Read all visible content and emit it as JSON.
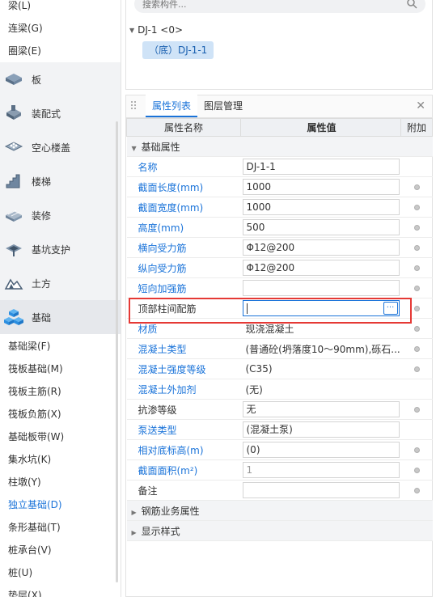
{
  "left_nav": {
    "top_items": [
      {
        "label": "梁(L)"
      },
      {
        "label": "连梁(G)"
      },
      {
        "label": "圈梁(E)"
      }
    ],
    "categories": [
      {
        "label": "板",
        "icon": "slab-icon"
      },
      {
        "label": "装配式",
        "icon": "prefab-icon"
      },
      {
        "label": "空心楼盖",
        "icon": "hollow-floor-icon"
      },
      {
        "label": "楼梯",
        "icon": "stairs-icon"
      },
      {
        "label": "装修",
        "icon": "decoration-icon"
      },
      {
        "label": "基坑支护",
        "icon": "pit-support-icon"
      },
      {
        "label": "土方",
        "icon": "earthwork-icon"
      },
      {
        "label": "基础",
        "icon": "foundation-icon",
        "active": true
      }
    ],
    "sub_items": [
      {
        "label": "基础梁(F)"
      },
      {
        "label": "筏板基础(M)"
      },
      {
        "label": "筏板主筋(R)"
      },
      {
        "label": "筏板负筋(X)"
      },
      {
        "label": "基础板带(W)"
      },
      {
        "label": "集水坑(K)"
      },
      {
        "label": "柱墩(Y)"
      },
      {
        "label": "独立基础(D)",
        "active": true
      },
      {
        "label": "条形基础(T)"
      },
      {
        "label": "桩承台(V)"
      },
      {
        "label": "桩(U)"
      },
      {
        "label": "垫层(X)"
      }
    ]
  },
  "component_panel": {
    "search_placeholder": "搜索构件...",
    "tree_root": "DJ-1 <0>",
    "tree_child": "（底）DJ-1-1"
  },
  "prop_panel": {
    "tabs": [
      "属性列表",
      "图层管理"
    ],
    "columns": {
      "name": "属性名称",
      "value": "属性值",
      "extra": "附加"
    },
    "group_basic": "基础属性",
    "rows": [
      {
        "name": "名称",
        "value": "DJ-1-1",
        "link": true,
        "box": true,
        "dot": false
      },
      {
        "name": "截面长度(mm)",
        "value": "1000",
        "link": true,
        "box": true,
        "dot": true
      },
      {
        "name": "截面宽度(mm)",
        "value": "1000",
        "link": true,
        "box": true,
        "dot": true
      },
      {
        "name": "高度(mm)",
        "value": "500",
        "link": true,
        "box": true,
        "dot": true
      },
      {
        "name": "横向受力筋",
        "value": "Φ12@200",
        "link": true,
        "box": true,
        "dot": true
      },
      {
        "name": "纵向受力筋",
        "value": "Φ12@200",
        "link": true,
        "box": true,
        "dot": true
      },
      {
        "name": "短向加强筋",
        "value": "",
        "link": true,
        "box": true,
        "dot": true
      },
      {
        "name": "顶部柱间配筋",
        "value": "",
        "link": false,
        "box": true,
        "dot": true,
        "editing": true
      },
      {
        "name": "材质",
        "value": "现浇混凝土",
        "link": true,
        "box": false,
        "dot": true
      },
      {
        "name": "混凝土类型",
        "value": "(普通砼(坍落度10～90mm),砾石...",
        "link": true,
        "box": false,
        "dot": true
      },
      {
        "name": "混凝土强度等级",
        "value": "(C35)",
        "link": true,
        "box": false,
        "dot": true
      },
      {
        "name": "混凝土外加剂",
        "value": "(无)",
        "link": true,
        "box": false,
        "dot": false
      },
      {
        "name": "抗渗等级",
        "value": "无",
        "link": false,
        "box": true,
        "dot": true
      },
      {
        "name": "泵送类型",
        "value": "(混凝土泵)",
        "link": true,
        "box": true,
        "dot": false
      },
      {
        "name": "相对底标高(m)",
        "value": "(0)",
        "link": true,
        "box": true,
        "dot": true
      },
      {
        "name": "截面面积(m²)",
        "value": "1",
        "link": true,
        "box": true,
        "dot": true,
        "readonly": true
      },
      {
        "name": "备注",
        "value": "",
        "link": false,
        "box": true,
        "dot": true
      }
    ],
    "group_rebar": "钢筋业务属性",
    "group_display": "显示样式"
  }
}
